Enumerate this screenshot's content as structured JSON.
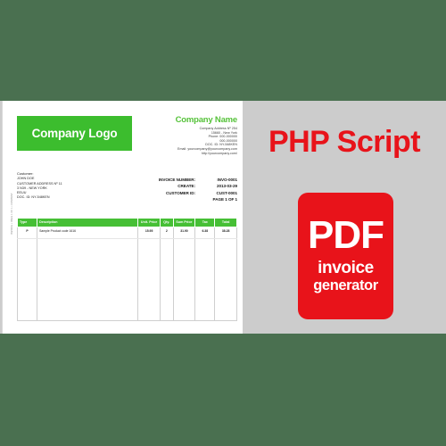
{
  "theme": {
    "band_color": "#4a7050",
    "strip_background": "#cccccc",
    "brand_green": "#3cbd2e",
    "table_header_green": "#46bf35",
    "promo_red": "#e8131a"
  },
  "invoice": {
    "logo_text": "Company Logo",
    "side_note": "INVOICE  •  PAGE 1 OF 1  •  COMPANY",
    "company": {
      "name": "Company Name",
      "address_lines": [
        "Company Address Nº 254",
        "15660 - New York",
        "Phone: 000-000000",
        "000-000000",
        "DOC. ID: NY-548KEN",
        "Email: yourcompany@yourcompany.com",
        "http://yourcompany.com/"
      ]
    },
    "customer": {
      "heading": "Customer:",
      "lines": [
        "JOHN DOE",
        "CUSTOMER ADDRESS Nº 11",
        "3 N39 - NEW YORK",
        "EEUU",
        "DOC. ID: NY-548KEN"
      ]
    },
    "meta": [
      {
        "label": "INVOICE NUMBER:",
        "value": "INVO-0001"
      },
      {
        "label": "CREATE:",
        "value": "2013-03-29"
      },
      {
        "label": "CUSTOMER ID:",
        "value": "CUST-0001"
      }
    ],
    "page_label": "PAGE 1 OF 1",
    "table": {
      "columns": [
        "Type",
        "Description",
        "Unit. Price",
        "Qty.",
        "Sum Price",
        "Tax",
        "Total"
      ],
      "rows": [
        {
          "type": "P",
          "description": "Sample Product code 1616",
          "unit_price": "15.95",
          "qty": "2",
          "sum_price": "31.90",
          "tax": "6.38",
          "total": "38.28"
        }
      ]
    }
  },
  "promo": {
    "headline": "PHP Script",
    "badge": {
      "title": "PDF",
      "subtitle_line1": "invoice",
      "subtitle_line2": "generator"
    }
  }
}
